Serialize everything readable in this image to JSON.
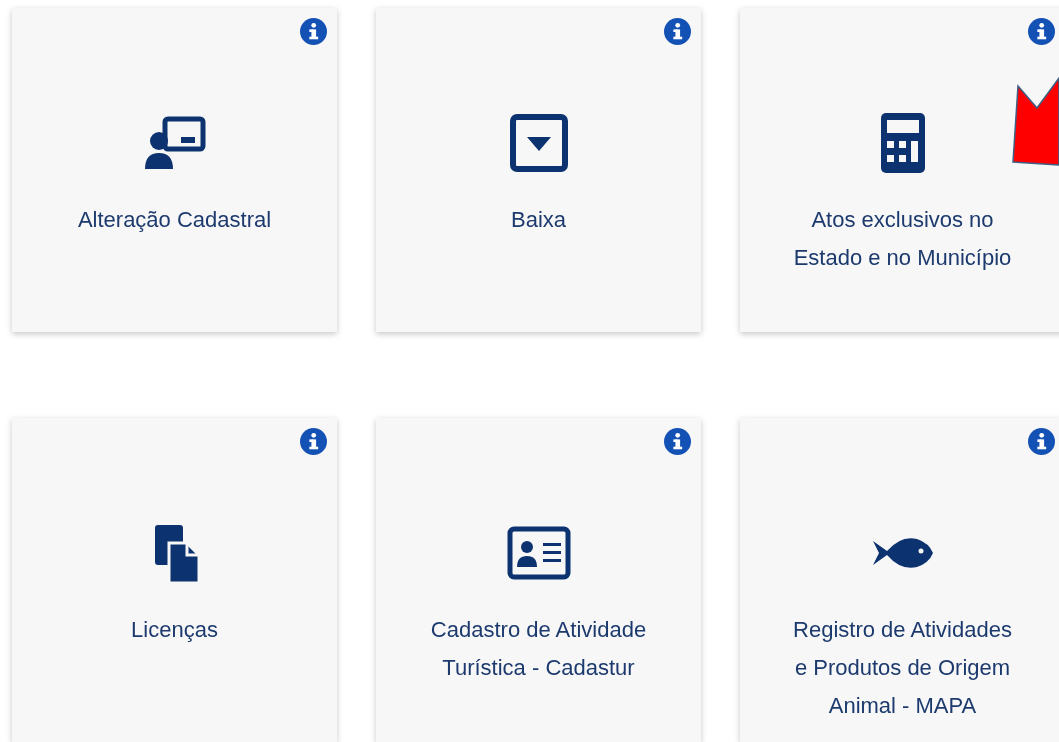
{
  "cards": [
    {
      "label": "Alteração Cadastral"
    },
    {
      "label": "Baixa"
    },
    {
      "label": "Atos exclusivos no Estado e no Município"
    },
    {
      "label": "Licenças"
    },
    {
      "label": "Cadastro de Atividade Turística - Cadastur"
    },
    {
      "label": "Registro de Atividades e Produtos de Origem Animal - MAPA"
    }
  ]
}
